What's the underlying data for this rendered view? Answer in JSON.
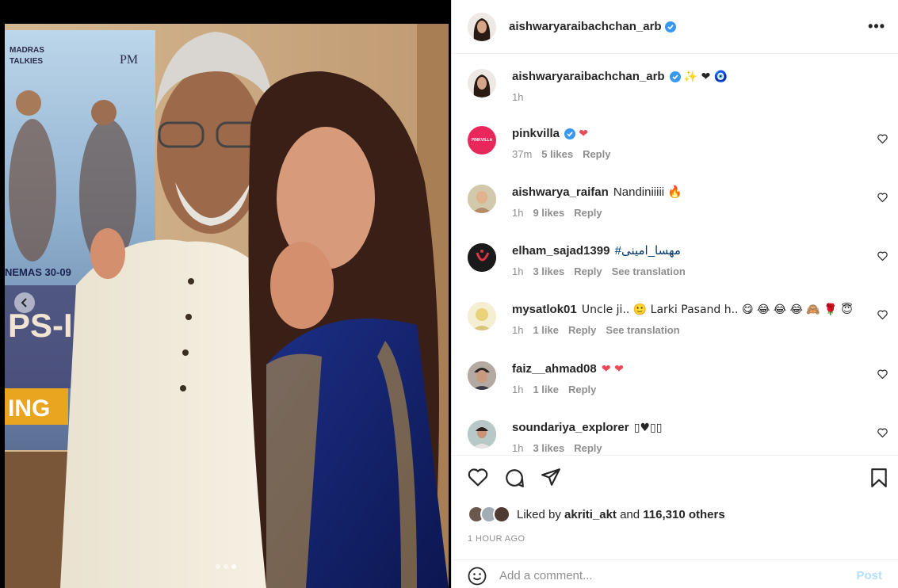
{
  "post": {
    "author": "aishwaryaraibachchan_arb",
    "caption_emoji": "✨ ❤ 🧿",
    "caption_time": "1h",
    "more_label": "•••"
  },
  "poster": {
    "brand_top": "MADRAS",
    "brand_bottom": "TALKIES",
    "logo": "PM",
    "release": "NEMAS 30-09",
    "title": "PS-I",
    "banner": "ING"
  },
  "comments": [
    {
      "user": "pinkvilla",
      "text": "❤",
      "time": "37m",
      "likes": "5 likes",
      "reply": "Reply",
      "translate": ""
    },
    {
      "user": "aishwarya_raifan",
      "text": "Nandiniiiii 🔥",
      "time": "1h",
      "likes": "9 likes",
      "reply": "Reply",
      "translate": ""
    },
    {
      "user": "elham_sajad1399",
      "text": "#مهسا_امینی",
      "time": "1h",
      "likes": "3 likes",
      "reply": "Reply",
      "translate": "See translation"
    },
    {
      "user": "mysatlok01",
      "text": "Uncle ji.. 🙂 Larki Pasand h.. 😋 😂 😂 😂 🙈 🌹 😇",
      "time": "1h",
      "likes": "1 like",
      "reply": "Reply",
      "translate": "See translation"
    },
    {
      "user": "faiz__ahmad08",
      "text": "❤ ❤",
      "time": "1h",
      "likes": "1 like",
      "reply": "Reply",
      "translate": ""
    },
    {
      "user": "soundariya_explorer",
      "text": "▯♥▯▯",
      "time": "1h",
      "likes": "3 likes",
      "reply": "Reply",
      "translate": ""
    }
  ],
  "likes": {
    "prefix": "Liked by",
    "user": "akriti_akt",
    "middle": "and",
    "count": "116,310 others"
  },
  "timestamp": "1 HOUR AGO",
  "add_comment": {
    "placeholder": "Add a comment...",
    "post_label": "Post"
  },
  "colors": {
    "verified": "#3897f0",
    "heart": "#ed4956",
    "link": "#00376b",
    "post_disabled": "#b2dffc",
    "pinkvilla": "#e8285a"
  },
  "icons": [
    "chevron-left-icon",
    "heart-icon",
    "comment-icon",
    "share-icon",
    "bookmark-icon",
    "emoji-icon",
    "verified-badge-icon",
    "more-icon"
  ]
}
